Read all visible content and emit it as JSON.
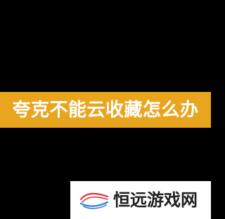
{
  "title_banner": {
    "text": "夸克不能云收藏怎么办",
    "background_color": "#eaa51f",
    "text_color": "#ffffff"
  },
  "watermark": {
    "text": "恒远游戏网",
    "logo_icon": "wave-logo-icon",
    "logo_colors": [
      "#e0303a",
      "#2e7fd6"
    ]
  },
  "page": {
    "background_color": "#000000"
  }
}
